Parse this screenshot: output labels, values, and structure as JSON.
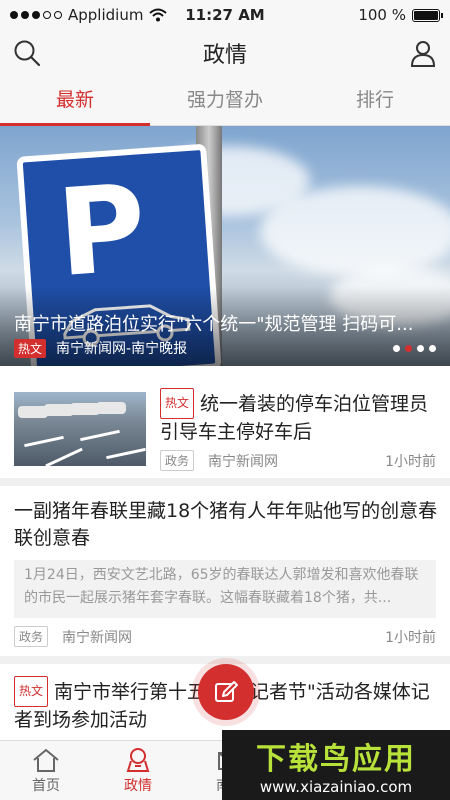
{
  "status_bar": {
    "carrier": "Applidium",
    "time": "11:27 AM",
    "battery": "100 %",
    "battery_level": 1.0
  },
  "nav": {
    "title": "政情",
    "left_icon": "search-icon",
    "right_icon": "user-icon"
  },
  "tabs": [
    {
      "label": "最新",
      "active": true
    },
    {
      "label": "强力督办",
      "active": false
    },
    {
      "label": "排行",
      "active": false
    }
  ],
  "banner": {
    "title": "南宁市道路泊位实行\"六个统一\"规范管理 扫码可...",
    "tag": "热文",
    "source": "南宁新闻网-南宁晚报",
    "page_count": 4,
    "active_page": 2
  },
  "articles": [
    {
      "tag": "热文",
      "title": "统一着装的停车泊位管理员引导车主停好车后",
      "category": "政务",
      "source": "南宁新闻网",
      "time": "1小时前"
    },
    {
      "title": "一副猪年春联里藏18个猪有人年年贴他写的创意春联创意春",
      "summary": "1月24日，西安文艺北路，65岁的春联达人郭增发和喜欢他春联的市民一起展示猪年套字春联。这幅春联藏着18个猪，共...",
      "category": "政务",
      "source": "南宁新闻网",
      "time": "1小时前"
    },
    {
      "tag": "热文",
      "title": "南宁市举行第十五届 国记者节\"活动各媒体记者到场参加活动"
    }
  ],
  "tab_bar": [
    {
      "label": "首页",
      "icon": "home-icon",
      "active": false
    },
    {
      "label": "政情",
      "icon": "government-icon",
      "active": true
    },
    {
      "label": "南宁",
      "icon": "mail-icon",
      "active": false
    }
  ],
  "fab_icon": "edit-icon",
  "watermark": {
    "text": "下载鸟应用",
    "url": "www.xiazainiao.com"
  },
  "colors": {
    "accent": "#d32f2f",
    "nav_bg": "#f7f7f7"
  }
}
